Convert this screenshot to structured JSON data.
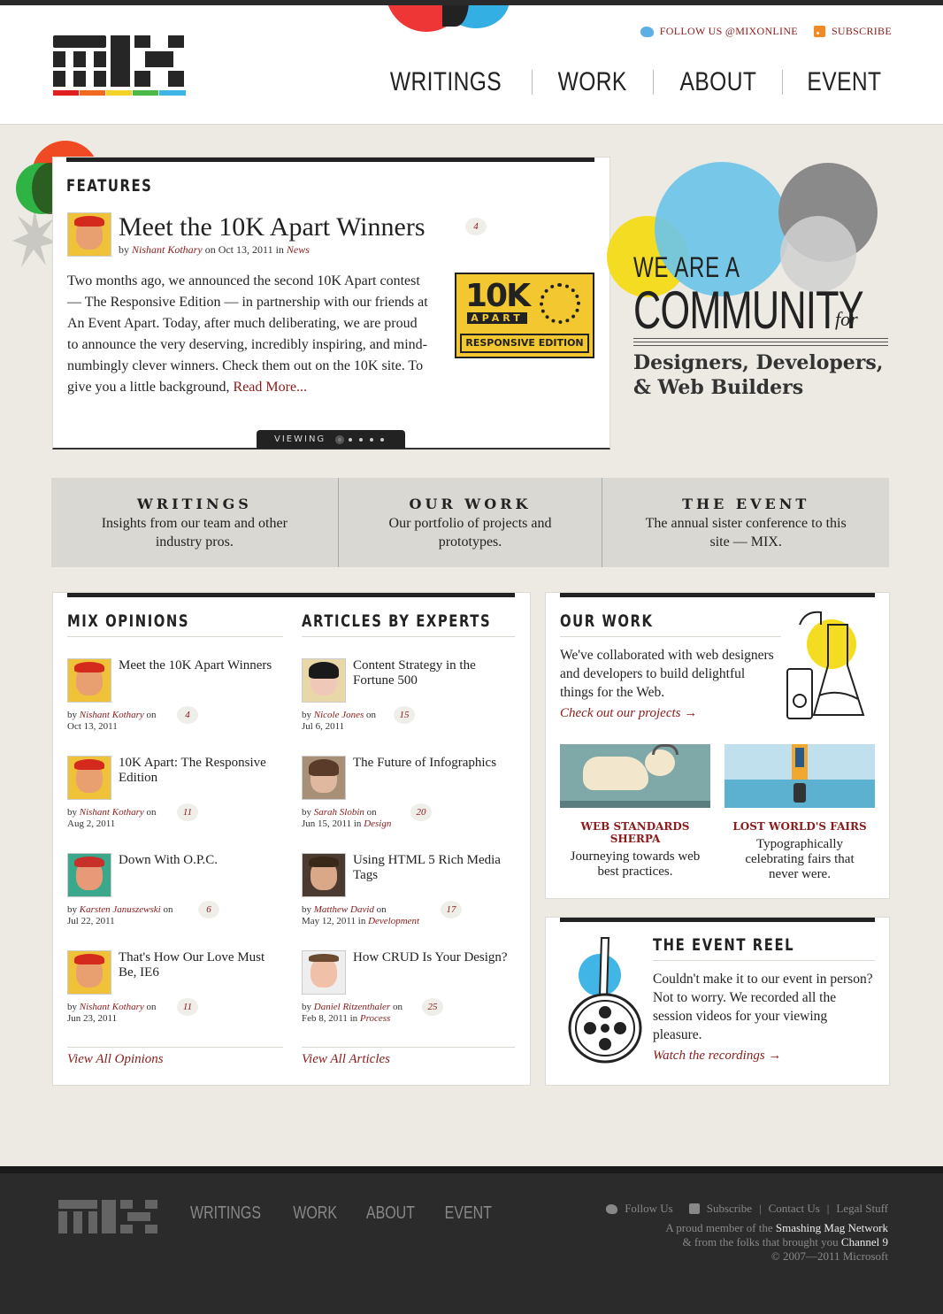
{
  "brand": {
    "logo_alt": "MIX"
  },
  "header": {
    "follow": "FOLLOW US @MIXONLINE",
    "subscribe": "SUBSCRIBE",
    "nav": [
      "WRITINGS",
      "WORK",
      "ABOUT",
      "EVENT"
    ]
  },
  "features": {
    "heading": "FEATURES",
    "title": "Meet the 10K Apart Winners",
    "comments": "4",
    "by_prefix": "by",
    "author": "Nishant Kothary",
    "on_text": "on Oct 13, 2011 in",
    "category": "News",
    "body": "Two months ago, we announced the second 10K Apart contest — The Responsive Edition — in partnership with our friends at An Event Apart. Today, after much deliberating, we are proud to announce the very deserving, incredibly inspiring, and mind-numbingly clever winners. Check them out on the 10K site. To give you a little background,",
    "read_more": "Read More...",
    "badge_big": "10K",
    "badge_small": "APART",
    "badge_edition": "RESPONSIVE EDITION",
    "viewing": "VIEWING"
  },
  "community": {
    "we_are": "WE ARE A",
    "word": "COMMUNITY",
    "for": "for",
    "sub": "Designers, Developers, & Web Builders"
  },
  "bands": [
    {
      "title": "WRITINGS",
      "desc": "Insights  from our team and other industry pros."
    },
    {
      "title": "OUR WORK",
      "desc": "Our portfolio of projects and prototypes."
    },
    {
      "title": "THE EVENT",
      "desc": "The annual sister conference to this site — MIX."
    }
  ],
  "opinions": {
    "heading": "MIX OPINIONS",
    "view_all": "View All Opinions",
    "items": [
      {
        "title": "Meet the 10K Apart Winners",
        "author": "Nishant Kothary",
        "date": "Oct 13, 2011",
        "category": "",
        "comments": "4"
      },
      {
        "title": "10K Apart: The Responsive Edition",
        "author": "Nishant Kothary",
        "date": "Aug 2, 2011",
        "category": "",
        "comments": "11"
      },
      {
        "title": "Down With O.P.C.",
        "author": "Karsten Januszewski",
        "date": "Jul 22, 2011",
        "category": "",
        "comments": "6"
      },
      {
        "title": "That's How Our Love Must Be, IE6",
        "author": "Nishant Kothary",
        "date": "Jun 23, 2011",
        "category": "",
        "comments": "11"
      }
    ]
  },
  "articles": {
    "heading": "ARTICLES BY EXPERTS",
    "view_all": "View All Articles",
    "items": [
      {
        "title": "Content Strategy in the Fortune 500",
        "author": "Nicole Jones",
        "date": "Jul 6, 2011",
        "category": "",
        "comments": "15"
      },
      {
        "title": "The Future of Infographics",
        "author": "Sarah Slobin",
        "date": "Jun 15, 2011",
        "category": "Design",
        "comments": "20"
      },
      {
        "title": "Using HTML 5 Rich Media Tags",
        "author": "Matthew David",
        "date": "May 12, 2011",
        "category": "Development",
        "comments": "17"
      },
      {
        "title": "How CRUD Is Your Design?",
        "author": "Daniel Ritzenthaler",
        "date": "Feb 8, 2011",
        "category": "Process",
        "comments": "25"
      }
    ]
  },
  "our_work": {
    "heading": "OUR WORK",
    "desc": "We've collaborated with web designers and developers to build delightful things for the Web.",
    "link": "Check out our projects →",
    "projects": [
      {
        "title": "WEB STANDARDS SHERPA",
        "desc": "Journeying towards web best practices."
      },
      {
        "title": "LOST WORLD'S FAIRS",
        "desc": "Typographically celebrating fairs that never were."
      }
    ]
  },
  "event_reel": {
    "heading": "THE EVENT REEL",
    "desc": "Couldn't make it to our event in person? Not to worry. We recorded all the session videos for your viewing pleasure.",
    "link": "Watch the recordings →"
  },
  "footer": {
    "nav": [
      "WRITINGS",
      "WORK",
      "ABOUT",
      "EVENT"
    ],
    "follow": "Follow Us",
    "subscribe": "Subscribe",
    "contact": "Contact Us",
    "legal": "Legal Stuff",
    "line1_pre": "A proud member of the",
    "line1_bold": "Smashing Mag Network",
    "line2_pre": "& from the folks that brought you",
    "line2_bold": "Channel 9",
    "copyright": "© 2007—2011 Microsoft"
  },
  "colors": {
    "accent": "#8b1a1a",
    "bars": [
      "#e02020",
      "#ef6a1f",
      "#f3d22a",
      "#4cb848",
      "#3fb5e6"
    ]
  }
}
